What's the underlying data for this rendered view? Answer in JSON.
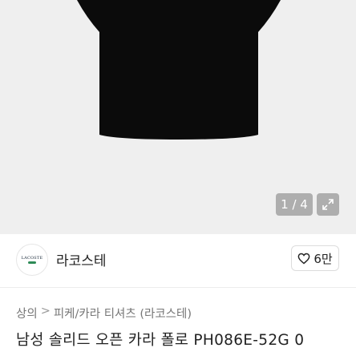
{
  "product_image": {
    "pager_text": "1 / 4"
  },
  "seller": {
    "logo_text": "LACOSTE",
    "name": "라코스테",
    "like_count": "6만"
  },
  "breadcrumb": {
    "items": [
      "상의",
      "피케/카라 티셔츠 (라코스테)"
    ],
    "separator": ">"
  },
  "product": {
    "title": "남성 솔리드 오픈 카라 폴로 PH086E-52G 0"
  }
}
